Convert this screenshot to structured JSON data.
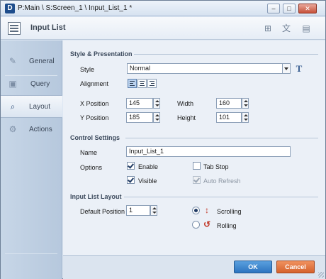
{
  "window": {
    "title": "P:Main \\ S:Screen_1 \\ Input_List_1 *",
    "app_icon_letter": "D",
    "controls": {
      "minimize": "–",
      "maximize": "□",
      "close": "✕"
    }
  },
  "header": {
    "title": "Input List"
  },
  "sidebar": {
    "items": [
      {
        "label": "General",
        "icon": "general-icon"
      },
      {
        "label": "Query",
        "icon": "query-icon"
      },
      {
        "label": "Layout",
        "icon": "layout-icon",
        "active": true
      },
      {
        "label": "Actions",
        "icon": "actions-icon"
      }
    ]
  },
  "style_presentation": {
    "section_title": "Style & Presentation",
    "style_label": "Style",
    "style_value": "Normal",
    "alignment_label": "Alignment",
    "alignment_selected": "left",
    "x_label": "X Position",
    "x_value": "145",
    "y_label": "Y Position",
    "y_value": "185",
    "width_label": "Width",
    "width_value": "160",
    "height_label": "Height",
    "height_value": "101"
  },
  "control_settings": {
    "section_title": "Control Settings",
    "name_label": "Name",
    "name_value": "Input_List_1",
    "options_label": "Options",
    "enable_label": "Enable",
    "enable_checked": true,
    "tabstop_label": "Tab Stop",
    "tabstop_checked": false,
    "visible_label": "Visible",
    "visible_checked": true,
    "autorefresh_label": "Auto Refresh",
    "autorefresh_checked": true,
    "autorefresh_disabled": true
  },
  "input_list_layout": {
    "section_title": "Input List Layout",
    "default_position_label": "Default Position",
    "default_position_value": "1",
    "scrolling_label": "Scrolling",
    "scrolling_selected": true,
    "rolling_label": "Rolling",
    "rolling_selected": false
  },
  "footer": {
    "ok_label": "OK",
    "cancel_label": "Cancel"
  },
  "colors": {
    "ok_button": "#2d74c0",
    "cancel_button": "#d5612c",
    "sidebar_bg": "#c7d6e7",
    "content_bg": "#ebf0f7"
  }
}
